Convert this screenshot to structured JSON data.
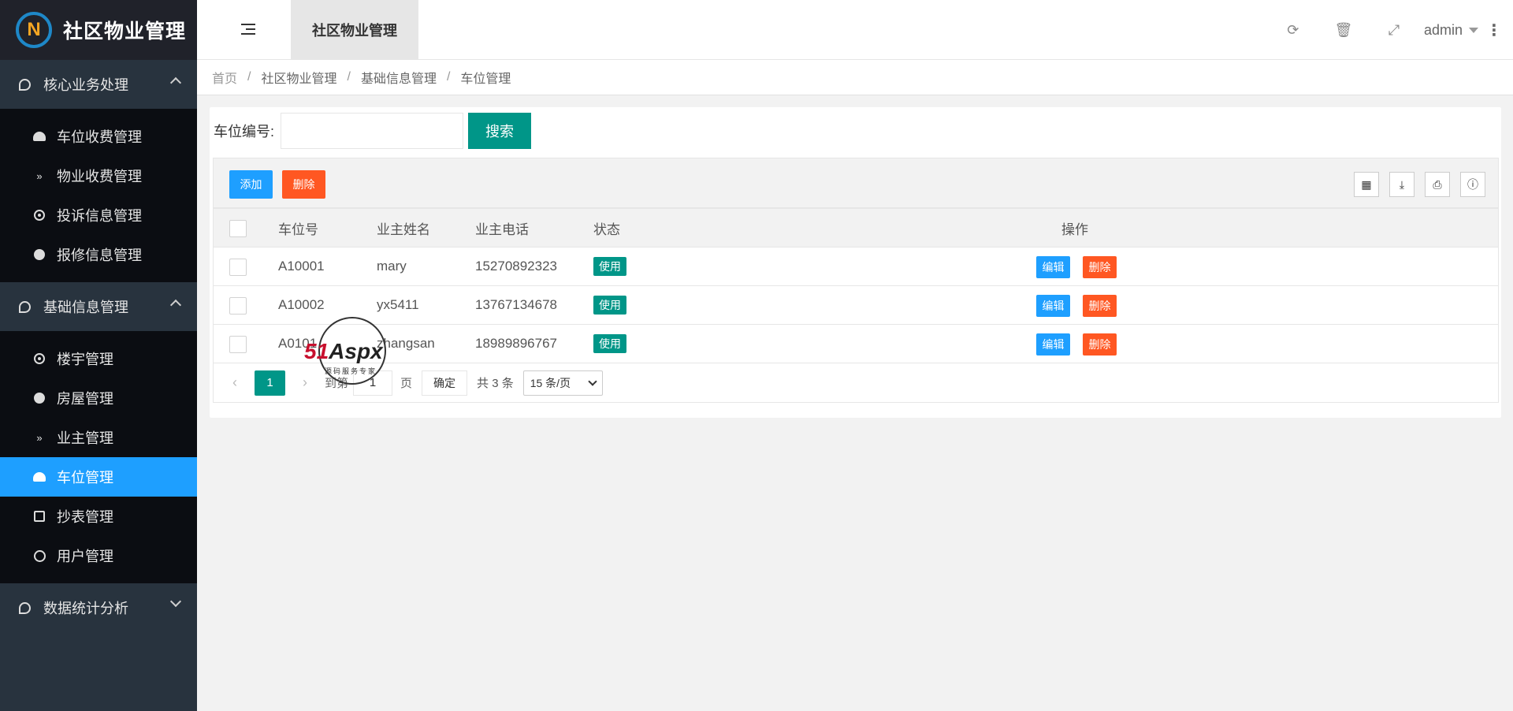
{
  "app": {
    "logo_letter": "N",
    "title": "社区物业管理"
  },
  "sidebar": {
    "groups": [
      {
        "label": "核心业务处理",
        "items": [
          {
            "label": "车位收费管理",
            "icon": "dashboard-icon"
          },
          {
            "label": "物业收费管理",
            "icon": "double-chevron-down-icon"
          },
          {
            "label": "投诉信息管理",
            "icon": "target-icon"
          },
          {
            "label": "报修信息管理",
            "icon": "up-circle-icon"
          }
        ]
      },
      {
        "label": "基础信息管理",
        "items": [
          {
            "label": "楼宇管理",
            "icon": "target-icon"
          },
          {
            "label": "房屋管理",
            "icon": "up-circle-icon"
          },
          {
            "label": "业主管理",
            "icon": "double-chevron-down-icon"
          },
          {
            "label": "车位管理",
            "icon": "dashboard-icon",
            "active": true
          },
          {
            "label": "抄表管理",
            "icon": "edit-icon"
          },
          {
            "label": "用户管理",
            "icon": "user-circle-icon"
          }
        ]
      },
      {
        "label": "数据统计分析",
        "items": []
      }
    ]
  },
  "header": {
    "tab": "社区物业管理",
    "icons": {
      "refresh": "⟳",
      "trash": "🗑",
      "fullscreen": "⤢"
    },
    "user": "admin",
    "more": "⋮"
  },
  "breadcrumb": [
    "首页",
    "社区物业管理",
    "基础信息管理",
    "车位管理"
  ],
  "breadcrumb_sep": "/",
  "search": {
    "label": "车位编号:",
    "button": "搜索",
    "value": ""
  },
  "toolbar": {
    "add": "添加",
    "delete": "删除",
    "icons": [
      "▦",
      "⤓",
      "⎙",
      "ⓘ"
    ]
  },
  "table": {
    "columns": [
      "车位号",
      "业主姓名",
      "业主电话",
      "状态",
      "操作"
    ],
    "rows": [
      {
        "spot": "A10001",
        "owner": "mary",
        "phone": "15270892323",
        "status": "使用"
      },
      {
        "spot": "A10002",
        "owner": "yx5411",
        "phone": "13767134678",
        "status": "使用"
      },
      {
        "spot": "A0101",
        "owner": "zhangsan",
        "phone": "18989896767",
        "status": "使用"
      }
    ],
    "edit_label": "编辑",
    "delete_label": "删除"
  },
  "pager": {
    "prev": "‹",
    "next": "›",
    "current": "1",
    "goto_label": "到第",
    "goto_value": "1",
    "page_label": "页",
    "ok": "确定",
    "total": "共 3 条",
    "page_size": "15 条/页"
  },
  "watermark": {
    "brand_red": "51",
    "brand_dark": "Aspx",
    "tagline": "源码服务专家"
  }
}
